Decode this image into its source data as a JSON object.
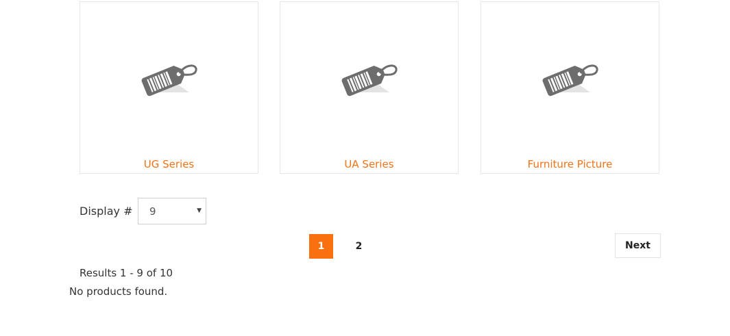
{
  "products": [
    {
      "title": "UG Series",
      "image_icon": "price-tag-icon"
    },
    {
      "title": "UA Series",
      "image_icon": "price-tag-icon"
    },
    {
      "title": "Furniture Picture",
      "image_icon": "price-tag-icon"
    }
  ],
  "display": {
    "label": "Display #",
    "selected": "9"
  },
  "pagination": {
    "pages": [
      "1",
      "2"
    ],
    "current": "1",
    "next_label": "Next"
  },
  "results_text": "Results 1 - 9 of 10",
  "empty_text": "No products found.",
  "colors": {
    "accent": "#f47216",
    "active_page_bg": "#f8700f"
  }
}
